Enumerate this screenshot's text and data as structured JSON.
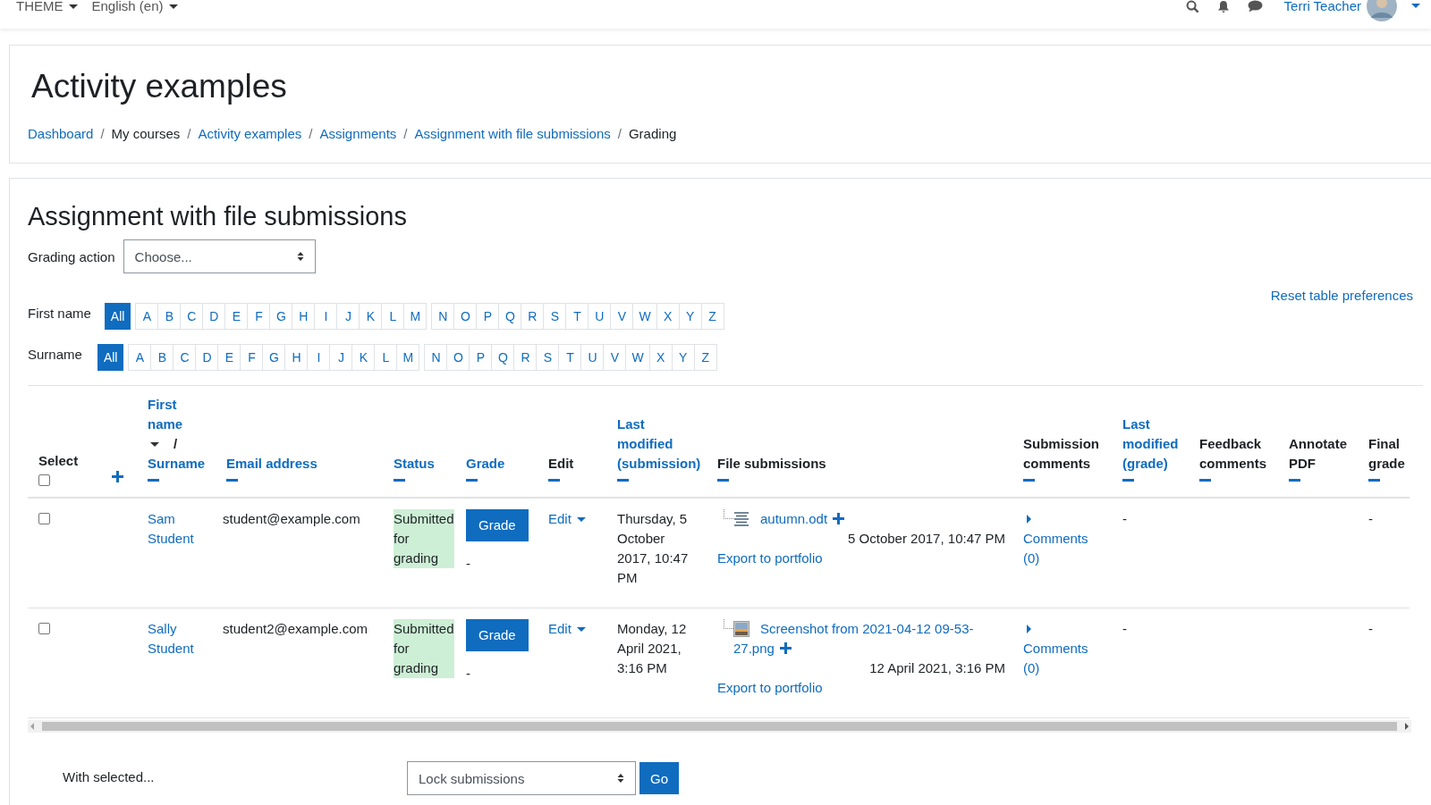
{
  "navbar": {
    "menus": [
      "THEME",
      "English (en)"
    ],
    "user": "Terri Teacher"
  },
  "header": {
    "title": "Activity examples",
    "separator": "/",
    "breadcrumb": [
      {
        "label": "Dashboard",
        "link": true
      },
      {
        "label": "My courses",
        "link": false
      },
      {
        "label": "Activity examples",
        "link": true
      },
      {
        "label": "Assignments",
        "link": true
      },
      {
        "label": "Assignment with file submissions",
        "link": true
      },
      {
        "label": "Grading",
        "link": false
      }
    ]
  },
  "assignment": {
    "title": "Assignment with file submissions",
    "grading_action": {
      "label": "Grading action",
      "value": "Choose..."
    },
    "reset_link": "Reset table preferences"
  },
  "filters": [
    {
      "label": "First name",
      "groups": [
        [
          {
            "label": "All",
            "selected": true
          }
        ],
        [
          {
            "label": "A",
            "selected": false
          },
          {
            "label": "B",
            "selected": false
          },
          {
            "label": "C",
            "selected": false
          },
          {
            "label": "D",
            "selected": false
          },
          {
            "label": "E",
            "selected": false
          },
          {
            "label": "F",
            "selected": false
          },
          {
            "label": "G",
            "selected": false
          },
          {
            "label": "H",
            "selected": false
          },
          {
            "label": "I",
            "selected": false
          },
          {
            "label": "J",
            "selected": false
          },
          {
            "label": "K",
            "selected": false
          },
          {
            "label": "L",
            "selected": false
          },
          {
            "label": "M",
            "selected": false
          }
        ],
        [
          {
            "label": "N",
            "selected": false
          },
          {
            "label": "O",
            "selected": false
          },
          {
            "label": "P",
            "selected": false
          },
          {
            "label": "Q",
            "selected": false
          },
          {
            "label": "R",
            "selected": false
          },
          {
            "label": "S",
            "selected": false
          },
          {
            "label": "T",
            "selected": false
          },
          {
            "label": "U",
            "selected": false
          },
          {
            "label": "V",
            "selected": false
          },
          {
            "label": "W",
            "selected": false
          },
          {
            "label": "X",
            "selected": false
          },
          {
            "label": "Y",
            "selected": false
          },
          {
            "label": "Z",
            "selected": false
          }
        ]
      ]
    },
    {
      "label": "Surname",
      "groups": [
        [
          {
            "label": "All",
            "selected": true
          }
        ],
        [
          {
            "label": "A",
            "selected": false
          },
          {
            "label": "B",
            "selected": false
          },
          {
            "label": "C",
            "selected": false
          },
          {
            "label": "D",
            "selected": false
          },
          {
            "label": "E",
            "selected": false
          },
          {
            "label": "F",
            "selected": false
          },
          {
            "label": "G",
            "selected": false
          },
          {
            "label": "H",
            "selected": false
          },
          {
            "label": "I",
            "selected": false
          },
          {
            "label": "J",
            "selected": false
          },
          {
            "label": "K",
            "selected": false
          },
          {
            "label": "L",
            "selected": false
          },
          {
            "label": "M",
            "selected": false
          }
        ],
        [
          {
            "label": "N",
            "selected": false
          },
          {
            "label": "O",
            "selected": false
          },
          {
            "label": "P",
            "selected": false
          },
          {
            "label": "Q",
            "selected": false
          },
          {
            "label": "R",
            "selected": false
          },
          {
            "label": "S",
            "selected": false
          },
          {
            "label": "T",
            "selected": false
          },
          {
            "label": "U",
            "selected": false
          },
          {
            "label": "V",
            "selected": false
          },
          {
            "label": "W",
            "selected": false
          },
          {
            "label": "X",
            "selected": false
          },
          {
            "label": "Y",
            "selected": false
          },
          {
            "label": "Z",
            "selected": false
          }
        ]
      ]
    }
  ],
  "table": {
    "columns": [
      {
        "kind": "select",
        "label": "Select",
        "checked": false
      },
      {
        "kind": "expand"
      },
      {
        "kind": "name",
        "label": "First name",
        "separator": "/",
        "label2": "Surname"
      },
      {
        "kind": "sortable",
        "label": "Email address"
      },
      {
        "kind": "sortable",
        "label": "Status"
      },
      {
        "kind": "sortable",
        "label": "Grade"
      },
      {
        "kind": "plain",
        "label": "Edit"
      },
      {
        "kind": "sortable",
        "label": "Last modified (submission)"
      },
      {
        "kind": "plain",
        "label": "File submissions"
      },
      {
        "kind": "plain",
        "label": "Submission comments"
      },
      {
        "kind": "sortable",
        "label": "Last modified (grade)"
      },
      {
        "kind": "plain",
        "label": "Feedback comments"
      },
      {
        "kind": "plain",
        "label": "Annotate PDF"
      },
      {
        "kind": "plain",
        "label": "Final grade"
      }
    ],
    "rows": [
      {
        "checked": false,
        "first": "Sam",
        "last": "Student",
        "email": "student@example.com",
        "status": "Submitted for grading",
        "grade_button": "Grade",
        "grade": "-",
        "edit": "Edit",
        "modified": "Thursday, 5 October 2017, 10:47 PM",
        "file": {
          "kind": "document",
          "name": "autumn.odt",
          "date": "5 October 2017, 10:47 PM"
        },
        "export": "Export to portfolio",
        "comments": "Comments (0)",
        "grade_modified": "-",
        "final_grade": "-"
      },
      {
        "checked": false,
        "first": "Sally",
        "last": "Student",
        "email": "student2@example.com",
        "status": "Submitted for grading",
        "grade_button": "Grade",
        "grade": "-",
        "edit": "Edit",
        "modified": "Monday, 12 April 2021, 3:16 PM",
        "file": {
          "kind": "image",
          "name": "Screenshot from 2021-04-12 09-53-27.png",
          "date": "12 April 2021, 3:16 PM"
        },
        "export": "Export to portfolio",
        "comments": "Comments (0)",
        "grade_modified": "-",
        "final_grade": "-"
      }
    ]
  },
  "bulk": {
    "label": "With selected...",
    "action": "Lock submissions",
    "button": "Go"
  }
}
